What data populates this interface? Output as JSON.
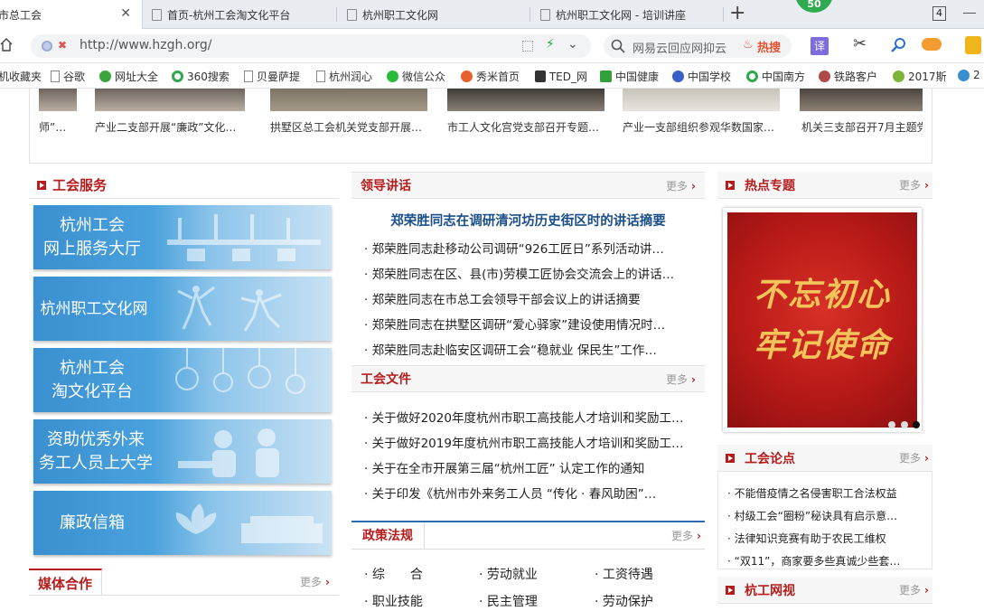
{
  "browser": {
    "tabs": [
      {
        "label": "市总工会",
        "active": true
      },
      {
        "label": "首页-杭州工会淘文化平台",
        "active": false
      },
      {
        "label": "杭州职工文化网",
        "active": false
      },
      {
        "label": "杭州职工文化网 - 培训讲座",
        "active": false
      }
    ],
    "new_tab_symbol": "+",
    "tab_count": "4",
    "badge_count": "50",
    "url": "http://www.hzgh.org/",
    "search_placeholder": "网易云回应网抑云",
    "hot_label": "热搜",
    "translate_label": "译",
    "bookmarks": [
      "机收藏夹",
      "谷歌",
      "网址大全",
      "360搜索",
      "贝曼萨提",
      "杭州润心",
      "微信公众",
      "秀米首页",
      "TED_网",
      "中国健康",
      "中国学校",
      "中国南方",
      "铁路客户",
      "2017斯",
      "2"
    ]
  },
  "gallery": {
    "captions": [
      "师”…",
      "产业二支部开展“廉政”文化…",
      "拱墅区总工会机关党支部开展…",
      "市工人文化宫党支部召开专题…",
      "产业一支部组织参观华数国家…",
      "机关三支部召开7月主题党"
    ]
  },
  "services": {
    "title": "工会服务",
    "buttons": [
      "杭州工会\n网上服务大厅",
      "杭州职工文化网",
      "杭州工会\n淘文化平台",
      "资助优秀外来\n务工人员上大学",
      "廉政信箱"
    ]
  },
  "media": {
    "title": "媒体合作",
    "more": "更多"
  },
  "speech": {
    "title": "领导讲话",
    "more": "更多",
    "headline": "郑荣胜同志在调研清河坊历史街区时的讲话摘要",
    "items": [
      "郑荣胜同志赴移动公司调研“926工匠日”系列活动讲…",
      "郑荣胜同志在区、县(市)劳模工匠协会交流会上的讲话…",
      "郑荣胜同志在市总工会领导干部会议上的讲话摘要",
      "郑荣胜同志在拱墅区调研“爱心驿家”建设使用情况时…",
      "郑荣胜同志赴临安区调研工会“稳就业 保民生”工作…"
    ]
  },
  "docs": {
    "title": "工会文件",
    "more": "更多",
    "items": [
      "关于做好2020年度杭州市职工高技能人才培训和奖励工…",
      "关于做好2019年度杭州市职工高技能人才培训和奖励工…",
      "关于在全市开展第三届“杭州工匠” 认定工作的通知",
      "关于印发《杭州市外来务工人员 “传化 · 春风助困”…"
    ]
  },
  "policy": {
    "title": "政策法规",
    "more": "更多",
    "items": [
      "综　　合",
      "劳动就业",
      "工资待遇",
      "职业技能",
      "民主管理",
      "劳动保护"
    ]
  },
  "hot": {
    "title": "热点专题",
    "more": "更多",
    "banner_text": "不忘初心\n牢记使命"
  },
  "forum": {
    "title": "工会论点",
    "more": "更多",
    "items": [
      "不能借疫情之名侵害职工合法权益",
      "村级工会“圈粉”秘诀具有启示意…",
      "法律知识竞赛有助于农民工维权",
      "“双11”，商家要多些真诚少些套…"
    ]
  },
  "tv": {
    "title": "杭工网视",
    "more": "更多"
  },
  "colors": {
    "accent": "#b71c1c",
    "headline": "#1a4f8a",
    "tabbar": "#e9edf2"
  }
}
